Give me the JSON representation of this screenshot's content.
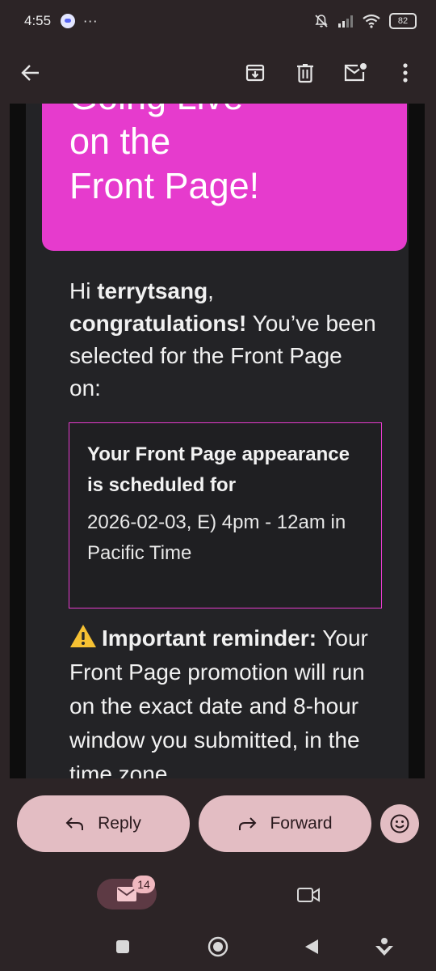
{
  "status_bar": {
    "time": "4:55",
    "more": "···",
    "battery": "82"
  },
  "app_bar": {
    "back": "back-arrow-icon",
    "actions": [
      "archive-icon",
      "delete-icon",
      "mark-unread-icon",
      "more-vert-icon"
    ]
  },
  "email": {
    "hero_title": "Going Live\non the\nFront Page!",
    "greeting_prefix": "Hi ",
    "username": "terrytsang",
    "greeting_comma": ",",
    "congrats": "congratulations!",
    "selected_text": " You’ve been selected for the Front Page on:",
    "schedule_heading": "Your Front Page appearance is scheduled for",
    "schedule_time": "2026-02-03, E) 4pm - 12am in Pacific Time",
    "reminder_heading": "Important reminder:",
    "reminder_text": " Your Front Page promotion will run on the exact date and 8-hour window you submitted, in the time zone"
  },
  "actions": {
    "reply_label": "Reply",
    "forward_label": "Forward",
    "emoji": "emoji-react-icon"
  },
  "bottom_nav": {
    "mail_badge": "14",
    "mail": "mail-icon",
    "meet": "video-icon"
  },
  "colors": {
    "background": "#2c2426",
    "hero": "#e63bcd",
    "pill": "#e3bdc3",
    "card": "#232326"
  }
}
